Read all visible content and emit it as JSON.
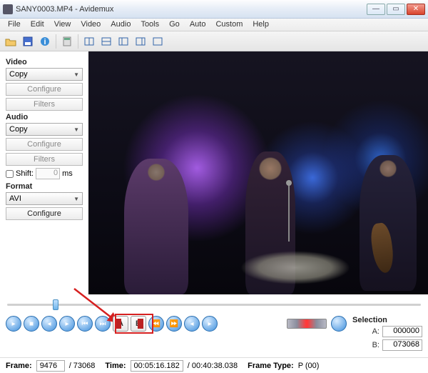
{
  "title": "SANY0003.MP4 - Avidemux",
  "menu": [
    "File",
    "Edit",
    "View",
    "Video",
    "Audio",
    "Tools",
    "Go",
    "Auto",
    "Custom",
    "Help"
  ],
  "toolbar_icons": [
    "open",
    "save",
    "info",
    "",
    "play-pause",
    "step",
    "",
    "crop-left",
    "crop-right",
    "",
    "mark-a",
    "mark-b"
  ],
  "side": {
    "video_label": "Video",
    "video_codec": "Copy",
    "configure": "Configure",
    "filters": "Filters",
    "audio_label": "Audio",
    "audio_codec": "Copy",
    "shift_label": "Shift:",
    "shift_value": "0",
    "shift_unit": "ms",
    "format_label": "Format",
    "format_value": "AVI"
  },
  "selection": {
    "label": "Selection",
    "a_label": "A:",
    "a_value": "000000",
    "b_label": "B:",
    "b_value": "073068"
  },
  "status": {
    "frame_label": "Frame:",
    "frame_value": "9476",
    "frame_total": "/ 73068",
    "time_label": "Time:",
    "time_value": "00:05:16.182",
    "time_total": "/ 00:40:38.038",
    "frametype_label": "Frame Type:",
    "frametype_value": "P (00)"
  },
  "marks": {
    "a": "A",
    "b": "B"
  }
}
